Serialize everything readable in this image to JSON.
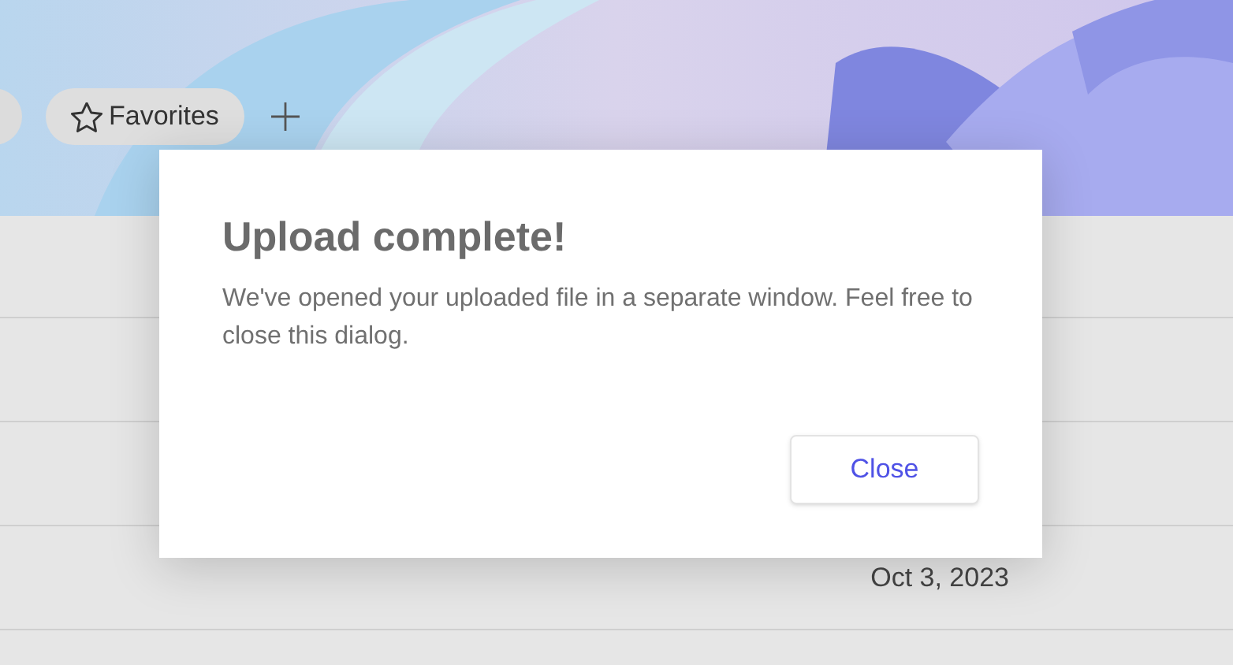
{
  "header": {
    "chips": [
      {
        "label": "Favorites",
        "kind": "favorite"
      }
    ]
  },
  "file_list": {
    "date": "Oct 3, 2023"
  },
  "dialog": {
    "title": "Upload complete!",
    "message": "We've opened your uploaded file in a separate window. Feel free to close this dialog.",
    "buttons": [
      "Close"
    ]
  }
}
